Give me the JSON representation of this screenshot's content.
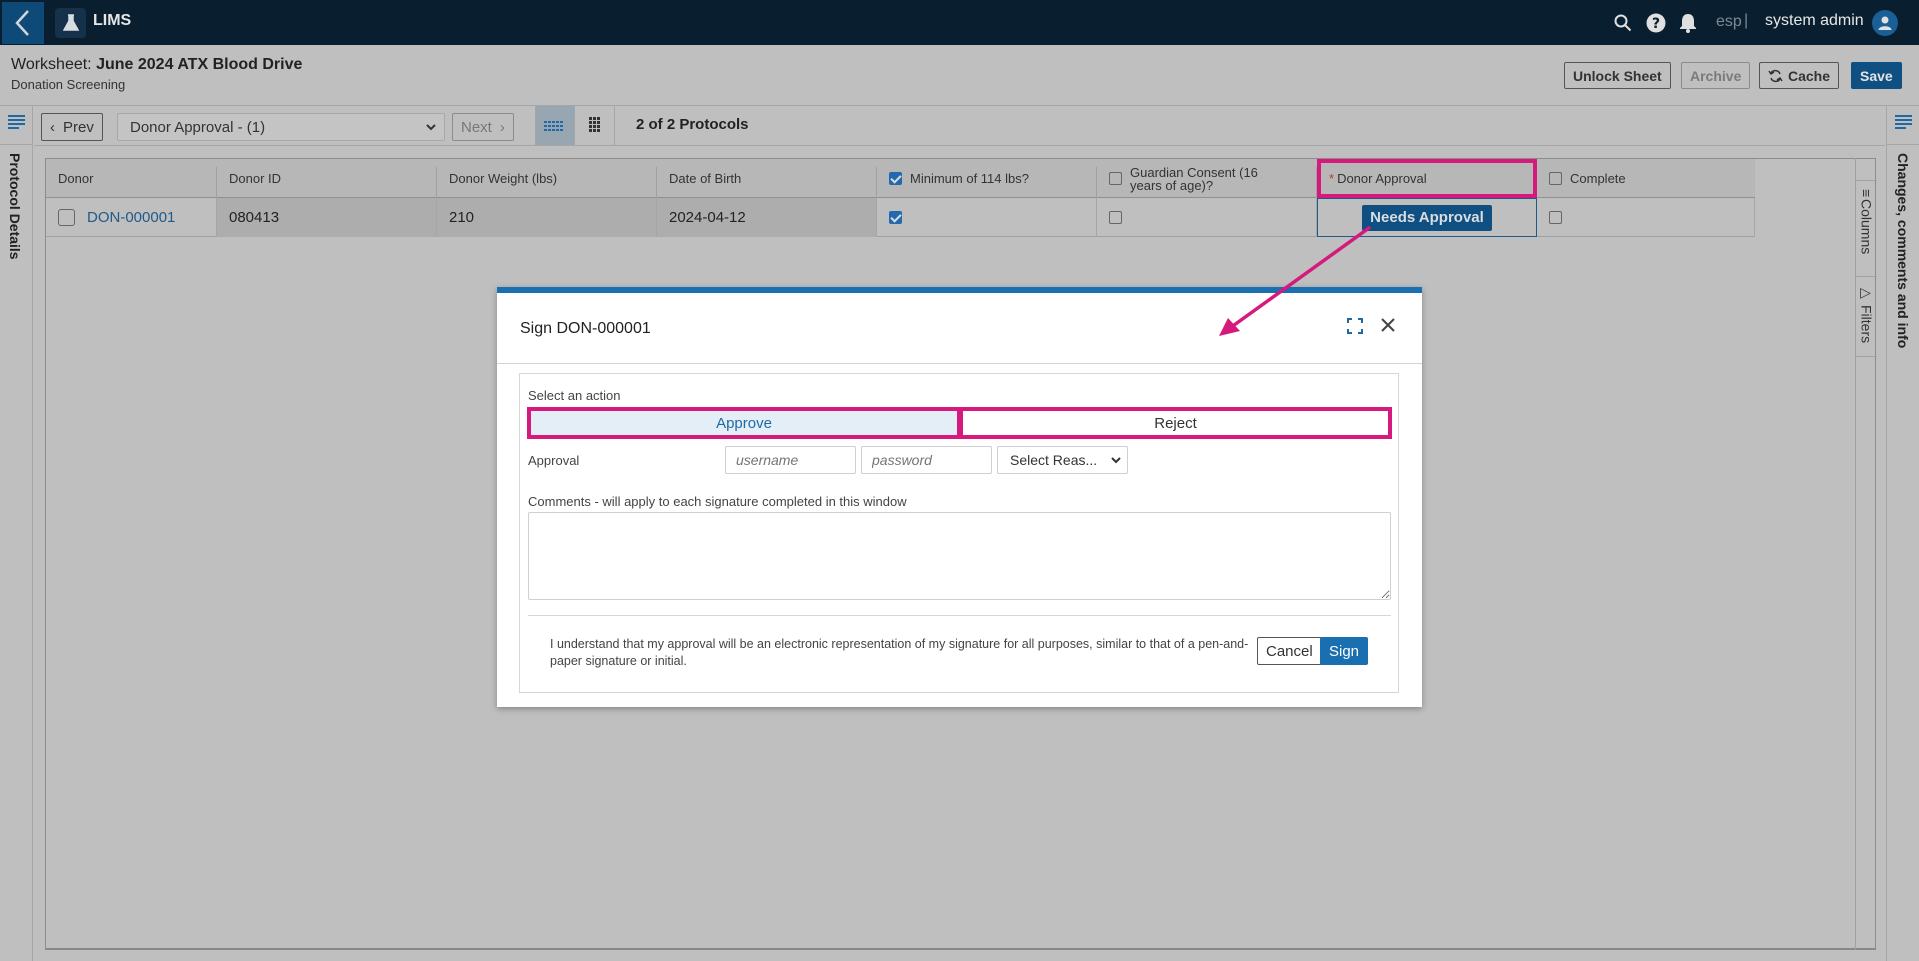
{
  "topbar": {
    "app_title": "LIMS",
    "environment": "esp",
    "separator": "|",
    "user_name": "system admin",
    "icons": [
      "back-chevron-icon",
      "flask-icon",
      "search-icon",
      "help-icon",
      "bell-icon",
      "user-avatar-icon"
    ]
  },
  "worksheet": {
    "label": "Worksheet: ",
    "name": "June 2024 ATX Blood Drive",
    "subtitle": "Donation Screening",
    "buttons": {
      "unlock": "Unlock Sheet",
      "archive": "Archive",
      "cache": "Cache",
      "save": "Save"
    }
  },
  "toolbar": {
    "prev": "Prev",
    "next": "Next",
    "protocol_selected": "Donor Approval - (1)",
    "protocol_count": "2 of 2 Protocols"
  },
  "side_panels": {
    "left": "Protocol Details",
    "right": "Changes, comments and info",
    "grid_tabs": [
      "Columns",
      "Filters"
    ]
  },
  "table": {
    "columns": [
      {
        "label": "Donor",
        "checkbox": false
      },
      {
        "label": "Donor ID",
        "checkbox": false
      },
      {
        "label": "Donor Weight (lbs)",
        "checkbox": false
      },
      {
        "label": "Date of Birth",
        "checkbox": false
      },
      {
        "label": "Minimum of 114 lbs?",
        "checkbox": true,
        "checked": true
      },
      {
        "label": "Guardian Consent (16 years of age)?",
        "checkbox": true,
        "checked": false
      },
      {
        "label": "Donor Approval",
        "required": true,
        "required_mark": "*"
      },
      {
        "label": "Complete",
        "checkbox": true,
        "checked": false
      }
    ],
    "rows": [
      {
        "donor": "DON-000001",
        "donor_id": "080413",
        "weight": "210",
        "dob": "2024-04-12",
        "minimum_114": true,
        "guardian_consent": false,
        "donor_approval": "Needs Approval",
        "complete": false
      }
    ]
  },
  "dialog": {
    "title": "Sign DON-000001",
    "select_action_label": "Select an action",
    "actions": [
      "Approve",
      "Reject"
    ],
    "selected_action": "Approve",
    "approval_label": "Approval",
    "username_placeholder": "username",
    "password_placeholder": "password",
    "reason_select": "Select Reas...",
    "comments_label": "Comments - will apply to each signature completed in this window",
    "comments_value": "",
    "attestation": "I understand that my approval will be an electronic representation of my signature for all purposes, similar to that of a pen-and-paper signature or initial.",
    "cancel": "Cancel",
    "sign": "Sign"
  },
  "annotation_color": "#d6197c",
  "accent_color": "#1a6fb0"
}
